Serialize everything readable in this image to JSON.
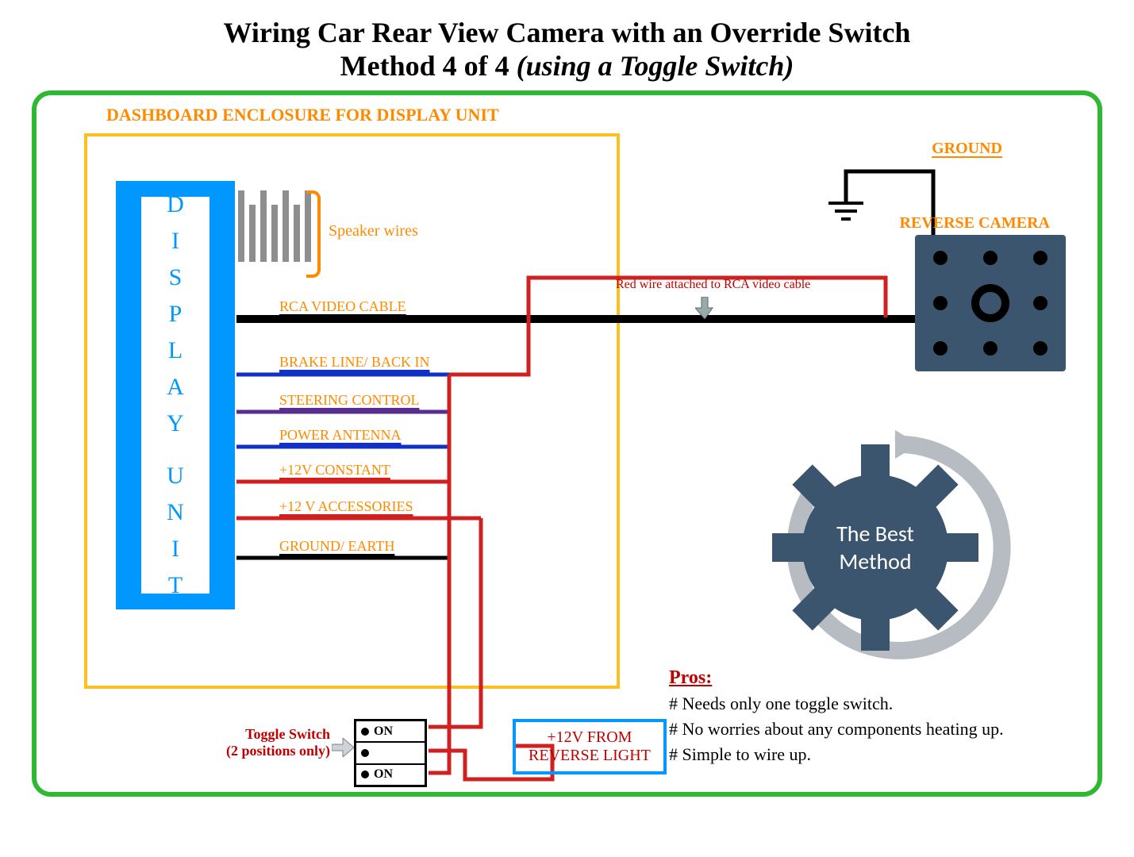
{
  "title": {
    "line1": "Wiring Car Rear View Camera with an Override Switch",
    "line2_prefix": "Method 4 of 4 ",
    "line2_italic": "(using a Toggle Switch)"
  },
  "dashboard_label": "DASHBOARD ENCLOSURE FOR DISPLAY UNIT",
  "display_unit_letters": [
    "D",
    "I",
    "S",
    "P",
    "L",
    "A",
    "Y",
    "U",
    "N",
    "I",
    "T"
  ],
  "speaker_wires_label": "Speaker wires",
  "rca_label": "RCA VIDEO CABLE",
  "wires": [
    {
      "label": "BRAKE LINE/ BACK IN",
      "color": "#1030c8"
    },
    {
      "label": "STEERING CONTROL",
      "color": "#5a2d8f"
    },
    {
      "label": "POWER ANTENNA",
      "color": "#1030c8"
    },
    {
      "label": "+12V CONSTANT",
      "color": "#d02020"
    },
    {
      "label": "+12 V ACCESSORIES",
      "color": "#d02020"
    },
    {
      "label": "GROUND/ EARTH",
      "color": "#000000"
    }
  ],
  "red_wire_note": "Red wire attached to RCA video cable",
  "ground_label": "GROUND",
  "reverse_camera_label": "REVERSE CAMERA",
  "toggle_switch": {
    "label_line1": "Toggle Switch",
    "label_line2": "(2 positions only)",
    "pos1": "ON",
    "pos2": "ON"
  },
  "reverse_light_box": {
    "line1": "+12V FROM",
    "line2": "REVERSE LIGHT"
  },
  "gear_text": {
    "line1": "The Best",
    "line2": "Method"
  },
  "pros": {
    "title": "Pros:",
    "items": [
      "# Needs only one toggle switch.",
      "# No worries about any components heating up.",
      "# Simple to wire up."
    ]
  }
}
